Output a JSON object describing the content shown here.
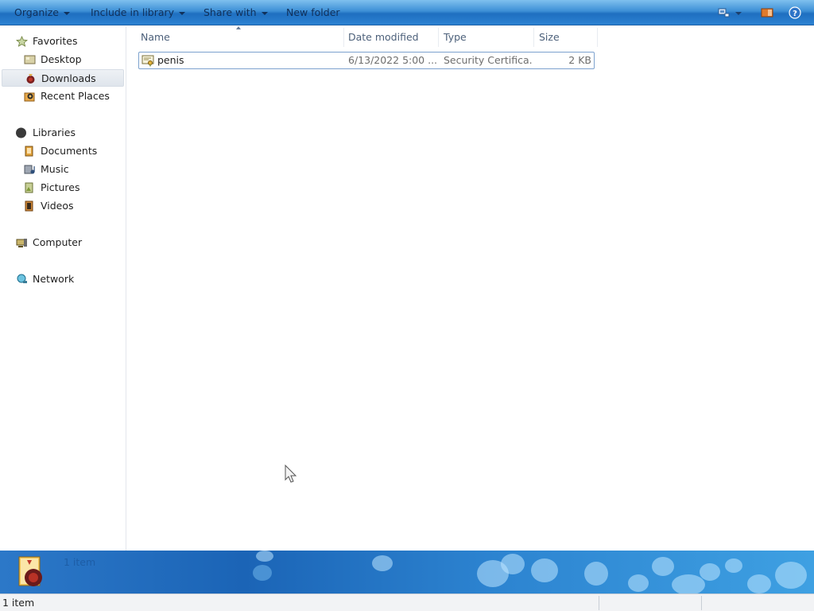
{
  "toolbar": {
    "organize": "Organize",
    "include_in_library": "Include in library",
    "share_with": "Share with",
    "new_folder": "New folder",
    "icons": [
      "change-view-icon",
      "view-options-icon",
      "preview-pane-icon",
      "help-icon"
    ]
  },
  "nav": {
    "favorites": "Favorites",
    "desktop": "Desktop",
    "downloads": "Downloads",
    "recent_places": "Recent Places",
    "libraries": "Libraries",
    "documents": "Documents",
    "music": "Music",
    "pictures": "Pictures",
    "videos": "Videos",
    "computer": "Computer",
    "network": "Network",
    "selected": "Downloads"
  },
  "columns": {
    "name": "Name",
    "date_modified": "Date modified",
    "type": "Type",
    "size": "Size"
  },
  "files": [
    {
      "name": "penis",
      "date_modified": "6/13/2022 5:00 ...",
      "type": "Security Certifica...",
      "size": "2 KB",
      "icon": "certificate-icon"
    }
  ],
  "details": {
    "item_count": "1 item"
  },
  "status": {
    "item_count": "1 item"
  },
  "colors": {
    "toolbar": "#3d8fd6",
    "selection_border": "#7da2ce",
    "details_pane": "#1b64b6"
  }
}
